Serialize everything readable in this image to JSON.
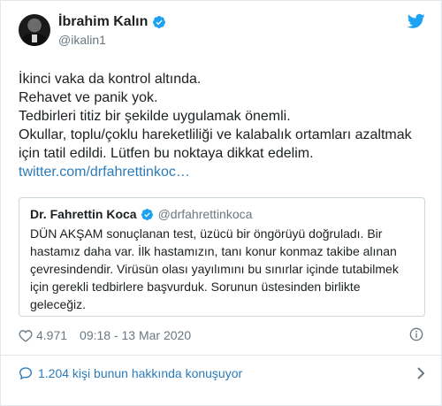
{
  "author": {
    "display_name": "İbrahim Kalın",
    "handle": "@ikalin1",
    "verified_icon": "verified-badge-icon"
  },
  "tweet": {
    "lines": [
      "İkinci vaka da kontrol altında.",
      "Rehavet ve panik yok.",
      "Tedbirleri titiz bir şekilde uygulamak önemli.",
      "Okullar, toplu/çoklu hareketliliği ve kalabalık ortamları azaltmak",
      "için tatil edildi. Lütfen bu noktaya dikkat edelim."
    ],
    "link": "twitter.com/drfahrettinkoc…"
  },
  "quoted": {
    "display_name": "Dr. Fahrettin Koca",
    "handle": "@drfahrettinkoca",
    "lines": [
      "DÜN AKŞAM sonuçlanan test, üzücü bir öngörüyü doğruladı. Bir",
      "hastamız daha var. İlk hastamızın, tanı konur konmaz takibe alınan",
      "çevresindendir. Virüsün olası yayılımını bu sınırlar içinde tutabilmek",
      "için gerekli tedbirlere başvurduk. Sorunun üstesinden birlikte",
      "geleceğiz."
    ]
  },
  "meta": {
    "likes": "4.971",
    "timestamp": "09:18 - 13 Mar 2020"
  },
  "footer": {
    "conversation": "1.204 kişi bunun hakkında konuşuyor"
  },
  "colors": {
    "link": "#2b7bb9",
    "secondary_text": "#697882",
    "verified": "#1da1f2",
    "border": "#e1e8ed"
  }
}
